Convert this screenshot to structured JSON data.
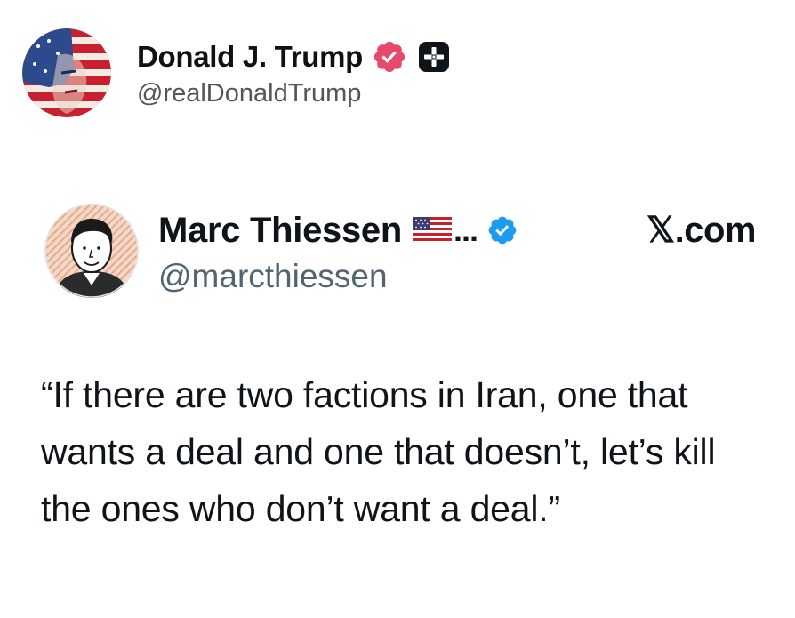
{
  "outer_post": {
    "display_name": "Donald J. Trump",
    "handle": "@realDonaldTrump",
    "verified_badge_icon": "verified-badge-icon",
    "verified_badge_color": "#e8496a",
    "secondary_badge_icon": "plus-badge-icon"
  },
  "quoted_post": {
    "display_name": "Marc Thiessen",
    "flag_icon": "us-flag-icon",
    "ellipsis": "...",
    "verified_badge_icon": "verified-badge-icon",
    "verified_badge_color": "#1d9bf0",
    "source_label": "𝕏.com",
    "handle": "@marcthiessen",
    "text": "“If there are two factions in Iran, one that wants a deal and one that doesn’t, let’s kill the ones who don’t want a deal.”"
  }
}
